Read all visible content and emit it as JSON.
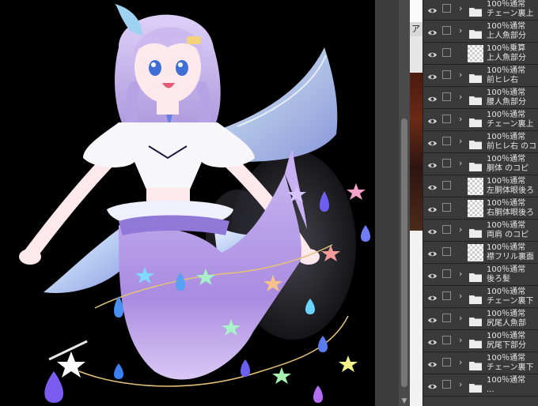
{
  "reference_window": {
    "partial_char": "ア"
  },
  "layer_panel": {
    "layers": [
      {
        "kind": "folder",
        "line1": "100％通常",
        "line2": "チェーン裏上"
      },
      {
        "kind": "folder",
        "line1": "100％通常",
        "line2": "上人魚部分"
      },
      {
        "kind": "raster",
        "line1": "100％乗算",
        "line2": "上人魚部分"
      },
      {
        "kind": "folder",
        "line1": "100％通常",
        "line2": "前ヒレ右"
      },
      {
        "kind": "folder",
        "line1": "100％通常",
        "line2": "腰人魚部分"
      },
      {
        "kind": "folder",
        "line1": "100％通常",
        "line2": "チェーン裏上"
      },
      {
        "kind": "folder",
        "line1": "100％通常",
        "line2": "前ヒレ右 のコ"
      },
      {
        "kind": "folder",
        "line1": "100％通常",
        "line2": "胴体 のコピ"
      },
      {
        "kind": "raster",
        "line1": "100％通常",
        "line2": "左胴体眼後ろ"
      },
      {
        "kind": "raster",
        "line1": "100％通常",
        "line2": "右胴体眼後ろ"
      },
      {
        "kind": "folder",
        "line1": "100％通常",
        "line2": "両肩 のコピ"
      },
      {
        "kind": "raster",
        "line1": "100％通常",
        "line2": "襟フリル裏面"
      },
      {
        "kind": "folder",
        "line1": "100％通常",
        "line2": "後ろ髪"
      },
      {
        "kind": "folder",
        "line1": "100％通常",
        "line2": "チェーン裏下"
      },
      {
        "kind": "folder",
        "line1": "100％通常",
        "line2": "尻尾人魚部"
      },
      {
        "kind": "folder",
        "line1": "100％通常",
        "line2": "尻尾下部分"
      },
      {
        "kind": "folder",
        "line1": "100％通常",
        "line2": "チェーン裏下"
      },
      {
        "kind": "folder",
        "line1": "100％通常",
        "line2": "..."
      }
    ]
  },
  "colors": {
    "canvas_bg": "#000000",
    "panel_bg": "#3a3a3a",
    "hair": "#c9b8ec",
    "tail": "#b79be8",
    "fin": "#c6d8f4"
  }
}
